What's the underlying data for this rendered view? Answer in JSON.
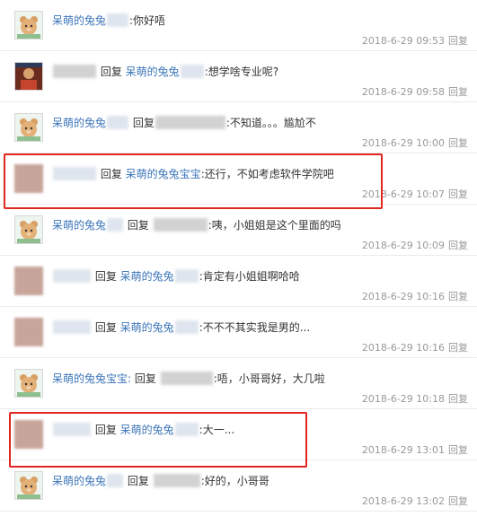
{
  "reply_word": "回复",
  "reply_link": "回复",
  "comments": [
    {
      "avatar": "bear-avatar",
      "author": "呆萌的兔兔",
      "is_reply": false,
      "target": "",
      "message": ":你好唔",
      "time": "2018-6-29 09:53"
    },
    {
      "avatar": "photo-avatar",
      "author": "",
      "is_reply": true,
      "target": "呆萌的兔兔",
      "message": ":想学啥专业呢?",
      "time": "2018-6-29 09:58"
    },
    {
      "avatar": "bear-avatar",
      "author": "呆萌的兔兔",
      "is_reply": true,
      "target": "",
      "message": ":不知道。。。尴尬不",
      "time": "2018-6-29 10:00"
    },
    {
      "avatar": "blur-avatar",
      "author": "",
      "is_reply": true,
      "target": "呆萌的兔兔宝宝",
      "message": ":还行，不如考虑软件学院吧",
      "time": "2018-6-29 10:07"
    },
    {
      "avatar": "bear-avatar",
      "author": "呆萌的兔兔",
      "is_reply": true,
      "target": "",
      "message": ":咦，小姐姐是这个里面的吗",
      "time": "2018-6-29 10:09"
    },
    {
      "avatar": "blur-avatar",
      "author": "",
      "is_reply": true,
      "target": "呆萌的兔兔",
      "message": ":肯定有小姐姐啊哈哈",
      "time": "2018-6-29 10:16"
    },
    {
      "avatar": "blur-avatar",
      "author": "",
      "is_reply": true,
      "target": "呆萌的兔兔",
      "message": ":不不不其实我是男的...",
      "time": "2018-6-29 10:16"
    },
    {
      "avatar": "bear-avatar",
      "author": "呆萌的兔兔宝宝:",
      "is_reply": true,
      "target": "",
      "message": ":唔，小哥哥好，大几啦",
      "time": "2018-6-29 10:18"
    },
    {
      "avatar": "blur-avatar",
      "author": "",
      "is_reply": true,
      "target": "呆萌的兔兔",
      "message": ":大一...",
      "time": "2018-6-29 13:01"
    },
    {
      "avatar": "bear-avatar",
      "author": "呆萌的兔兔",
      "is_reply": true,
      "target": "",
      "message": ":好的，小哥哥",
      "time": "2018-6-29 13:02"
    }
  ]
}
